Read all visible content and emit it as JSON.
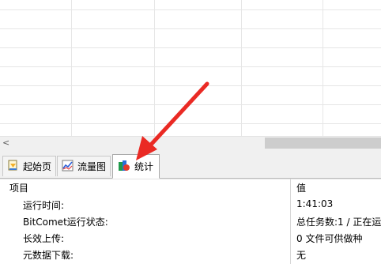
{
  "tabs": [
    {
      "label": "起始页",
      "icon": "home-page-icon"
    },
    {
      "label": "流量图",
      "icon": "line-chart-icon"
    },
    {
      "label": "统计",
      "icon": "statistics-icon"
    }
  ],
  "stats_table": {
    "header": {
      "item": "项目",
      "value": "值"
    },
    "rows": [
      {
        "label": "运行时间:",
        "value": "1:41:03"
      },
      {
        "label": "BitComet运行状态:",
        "value": "总任务数:1 / 正在运"
      },
      {
        "label": "长效上传:",
        "value": "0 文件可供做种"
      },
      {
        "label": "元数据下载:",
        "value": "无"
      }
    ]
  },
  "scrollbar": {
    "left_arrow": "<"
  },
  "annotation": {
    "type": "red-arrow",
    "color": "#ea2a24",
    "points_to": "统计"
  }
}
